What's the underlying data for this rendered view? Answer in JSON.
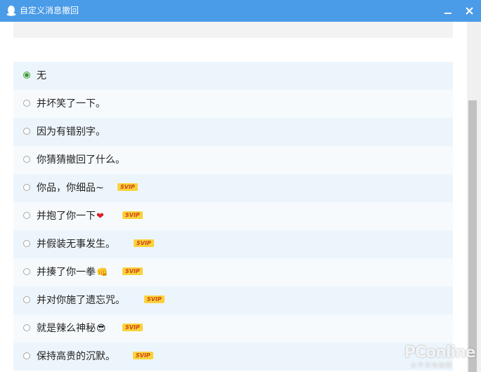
{
  "window": {
    "title": "自定义消息撤回",
    "accent": "#4a9be8"
  },
  "options": [
    {
      "label": "无",
      "selected": true,
      "svip": false
    },
    {
      "label": "并坏笑了一下。",
      "selected": false,
      "svip": false
    },
    {
      "label": "因为有错别字。",
      "selected": false,
      "svip": false
    },
    {
      "label": "你猜猜撤回了什么。",
      "selected": false,
      "svip": false
    },
    {
      "label": "你品，你细品~",
      "selected": false,
      "svip": true
    },
    {
      "label": "并抱了你一下",
      "emoji": "❤",
      "selected": false,
      "svip": true
    },
    {
      "label": "并假装无事发生。",
      "selected": false,
      "svip": true
    },
    {
      "label": "并揍了你一拳",
      "emoji": "👊",
      "selected": false,
      "svip": true
    },
    {
      "label": "并对你施了遗忘咒。",
      "selected": false,
      "svip": true
    },
    {
      "label": "就是辣么神秘",
      "emoji": "😎",
      "selected": false,
      "svip": true
    },
    {
      "label": "保持高贵的沉默。",
      "selected": false,
      "svip": true
    }
  ],
  "badge": {
    "svip_text": "SVIP"
  },
  "watermark": {
    "brand": "PConline",
    "sub": "太平洋电脑网"
  }
}
